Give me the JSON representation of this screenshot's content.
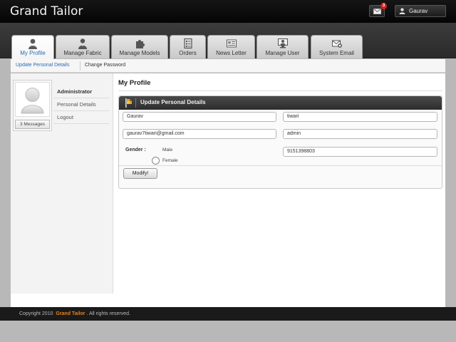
{
  "app": {
    "brand": "Grand Tailor"
  },
  "header": {
    "mail_count": "3",
    "user_name": "Gaurav"
  },
  "tabs": [
    {
      "label": "My Profile",
      "icon": "user-icon",
      "active": true
    },
    {
      "label": "Manage Fabric",
      "icon": "fabric-user-icon",
      "active": false
    },
    {
      "label": "Manage Models",
      "icon": "puzzle-icon",
      "active": false
    },
    {
      "label": "Orders",
      "icon": "checklist-icon",
      "active": false
    },
    {
      "label": "News Letter",
      "icon": "newsletter-icon",
      "active": false
    },
    {
      "label": "Manage User",
      "icon": "monitor-user-icon",
      "active": false
    },
    {
      "label": "System Email",
      "icon": "email-icon",
      "active": false
    }
  ],
  "subnav": [
    {
      "label": "Update Personal Details",
      "active": true
    },
    {
      "label": "Change Password",
      "active": false
    }
  ],
  "sidebar": {
    "messages_label": "3 Messages",
    "menu": [
      {
        "label": "Administrator"
      },
      {
        "label": "Personal Details"
      },
      {
        "label": "Logout"
      }
    ]
  },
  "content": {
    "page_title": "My Profile",
    "panel_title": "Update Personal Details",
    "form": {
      "first_name": "Gaurav",
      "last_name": "tiwari",
      "email": "gaurav7tiwari@gmail.com",
      "username": "admin",
      "gender_label": "Gender :",
      "gender_options": [
        "Male",
        "Female"
      ],
      "phone": "9151398803",
      "modify_label": "Modify!"
    }
  },
  "footer": {
    "copyright_prefix": "Copyright 2010",
    "brand": "Grand Tailor",
    "suffix": ". All rights reserved."
  },
  "colors": {
    "accent": "#2a6bb3",
    "brand_footer": "#e8811f",
    "badge": "#d71f1f"
  }
}
